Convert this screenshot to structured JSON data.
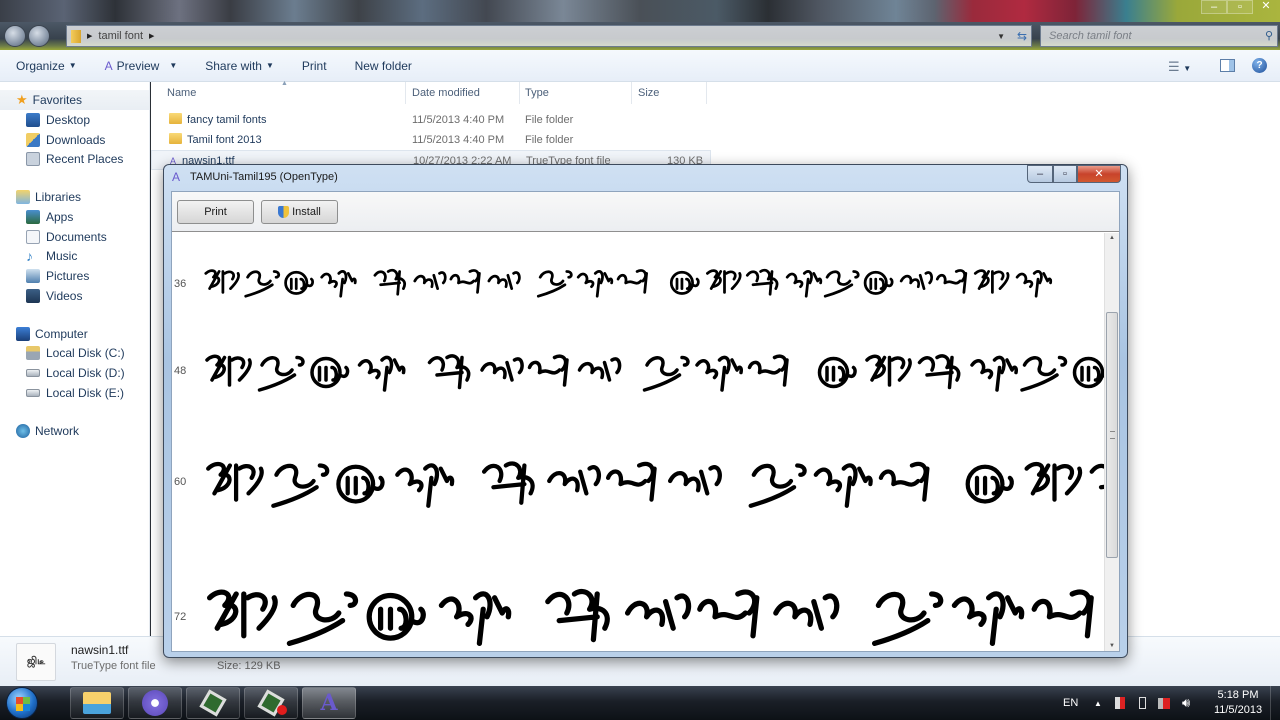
{
  "explorer": {
    "breadcrumb": [
      "tamil font"
    ],
    "search_placeholder": "Search tamil font",
    "toolbar": {
      "organize": "Organize",
      "preview": "Preview",
      "share_with": "Share with",
      "print": "Print",
      "new_folder": "New folder"
    },
    "sidebar": {
      "favorites": {
        "label": "Favorites",
        "items": [
          "Desktop",
          "Downloads",
          "Recent Places"
        ]
      },
      "libraries": {
        "label": "Libraries",
        "items": [
          "Apps",
          "Documents",
          "Music",
          "Pictures",
          "Videos"
        ]
      },
      "computer": {
        "label": "Computer",
        "items": [
          "Local Disk (C:)",
          "Local Disk (D:)",
          "Local Disk (E:)"
        ]
      },
      "network": {
        "label": "Network"
      }
    },
    "columns": {
      "name": "Name",
      "date": "Date modified",
      "type": "Type",
      "size": "Size"
    },
    "files": [
      {
        "name": "fancy tamil fonts",
        "date": "11/5/2013 4:40 PM",
        "type": "File folder",
        "size": "",
        "kind": "folder"
      },
      {
        "name": "Tamil font 2013",
        "date": "11/5/2013 4:40 PM",
        "type": "File folder",
        "size": "",
        "kind": "folder"
      },
      {
        "name": "nawsin1.ttf",
        "date": "10/27/2013 2:22 AM",
        "type": "TrueType font file",
        "size": "130 KB",
        "kind": "font"
      }
    ],
    "details": {
      "filename": "nawsin1.ttf",
      "filetype": "TrueType font file",
      "size": "Size: 129 KB",
      "thumb_text": "ஜிடீ"
    }
  },
  "font_viewer": {
    "title": "TAMUni-Tamil195 (OpenType)",
    "print_label": "Print",
    "install_label": "Install",
    "sample_sizes": [
      "36",
      "48",
      "60",
      "72"
    ],
    "scroll_position": 0.45
  },
  "taskbar": {
    "apps": [
      "windows-explorer",
      "bittorrent",
      "app-green-1",
      "app-green-2-recording",
      "font-viewer"
    ],
    "language": "EN",
    "time": "5:18 PM",
    "date": "11/5/2013"
  }
}
